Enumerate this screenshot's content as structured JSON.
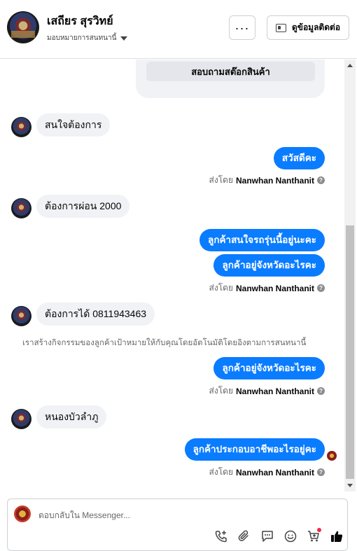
{
  "header": {
    "contact_name": "เสถียร สุรวิทย์",
    "assign_label": "มอบหมายการสนทนานี้",
    "more_label": "···",
    "contact_info_label": "ดูข้อมูลติดต่อ"
  },
  "card": {
    "action_label": "สอบถามสต๊อกสินค้า"
  },
  "messages": [
    {
      "direction": "in",
      "text": "สนใจต้องการ"
    },
    {
      "direction": "out",
      "text": "สวัสดีคะ"
    },
    {
      "direction": "in",
      "text": "ต้องการผ่อน 2000"
    },
    {
      "direction": "out",
      "text": "ลูกค้าสนใจรถรุ่นนี้อยู่นะคะ"
    },
    {
      "direction": "out",
      "text": "ลูกค้าอยู่จังหวัดอะไรคะ"
    },
    {
      "direction": "in",
      "text": "ต้องการได้ 0811943463"
    },
    {
      "direction": "out",
      "text": "ลูกค้าอยู่จังหวัดอะไรคะ"
    },
    {
      "direction": "in",
      "text": "หนองบัวลำภู"
    },
    {
      "direction": "out",
      "text": "ลูกค้าประกอบอาชีพอะไรอยู่คะ"
    }
  ],
  "sent_by": {
    "prefix": "ส่งโดย",
    "name": "Nanwhan Nanthanit"
  },
  "system_message": "เราสร้างกิจกรรมของลูกค้าเป้าหมายให้กับคุณโดยอัตโนมัติโดยอิงตามการสนทนานี้",
  "composer": {
    "placeholder": "ตอบกลับใน Messenger..."
  },
  "colors": {
    "outgoing_bubble": "#0a7cff",
    "incoming_bubble": "#f0f2f5",
    "notification_dot": "#f02849"
  },
  "icons": [
    "phone-add-icon",
    "attachment-icon",
    "saved-reply-icon",
    "emoji-icon",
    "cart-icon",
    "like-icon"
  ]
}
